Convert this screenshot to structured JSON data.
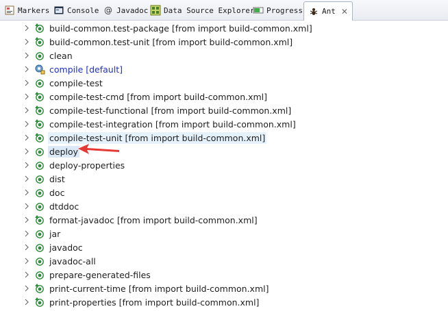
{
  "tabs": [
    {
      "label": "Markers",
      "icon": "markers-icon"
    },
    {
      "label": "Console",
      "icon": "console-icon"
    },
    {
      "label": "Javadoc",
      "icon": "javadoc-icon"
    },
    {
      "label": "Data Source Explorer",
      "icon": "data-source-explorer-icon"
    },
    {
      "label": "Progress",
      "icon": "progress-icon"
    },
    {
      "label": "Ant",
      "icon": "ant-icon",
      "active": true
    }
  ],
  "targets": [
    {
      "label": "build-common.test-package [from import build-common.xml]",
      "icon": "imported-target-icon"
    },
    {
      "label": "build-common.test-unit [from import build-common.xml]",
      "icon": "imported-target-icon"
    },
    {
      "label": "clean",
      "icon": "target-icon"
    },
    {
      "label": "compile [default]",
      "icon": "default-target-icon",
      "default": true
    },
    {
      "label": "compile-test",
      "icon": "target-icon"
    },
    {
      "label": "compile-test-cmd [from import build-common.xml]",
      "icon": "imported-target-icon"
    },
    {
      "label": "compile-test-functional [from import build-common.xml]",
      "icon": "imported-target-icon"
    },
    {
      "label": "compile-test-integration [from import build-common.xml]",
      "icon": "imported-target-icon"
    },
    {
      "label": "compile-test-unit [from import build-common.xml]",
      "icon": "imported-target-icon",
      "hover": true
    },
    {
      "label": "deploy",
      "icon": "target-icon",
      "selected": true
    },
    {
      "label": "deploy-properties",
      "icon": "target-icon"
    },
    {
      "label": "dist",
      "icon": "target-icon"
    },
    {
      "label": "doc",
      "icon": "target-icon"
    },
    {
      "label": "dtddoc",
      "icon": "target-icon"
    },
    {
      "label": "format-javadoc [from import build-common.xml]",
      "icon": "imported-target-icon"
    },
    {
      "label": "jar",
      "icon": "target-icon"
    },
    {
      "label": "javadoc",
      "icon": "target-icon"
    },
    {
      "label": "javadoc-all",
      "icon": "target-icon"
    },
    {
      "label": "prepare-generated-files",
      "icon": "target-icon"
    },
    {
      "label": "print-current-time [from import build-common.xml]",
      "icon": "imported-target-icon"
    },
    {
      "label": "print-properties [from import build-common.xml]",
      "icon": "imported-target-icon"
    }
  ],
  "colors": {
    "arrow": "#e53935",
    "target_green": "#2e8b3a",
    "default_blue": "#1f2fc4"
  }
}
